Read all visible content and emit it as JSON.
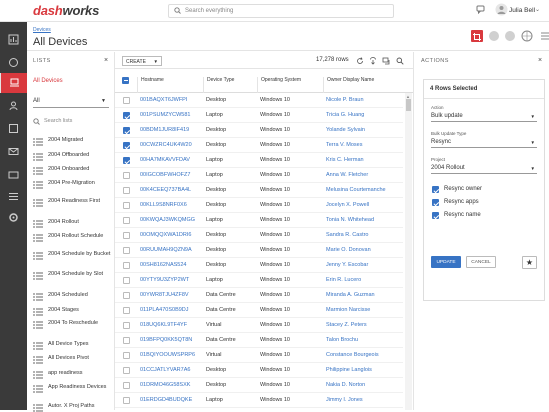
{
  "app": {
    "logo_a": "dash",
    "logo_b": "works",
    "search_placeholder": "Search everything",
    "user_name": "Julia Bell"
  },
  "page": {
    "breadcrumb": "Devices",
    "title": "All Devices"
  },
  "lists_panel": {
    "header": "LISTS",
    "all_label": "All Devices",
    "filter_value": "All",
    "search_placeholder": "Search lists",
    "items": [
      "2004 Migrated",
      "2004 Offboarded",
      "2004 Onboarded",
      "2004 Pre-Migration",
      "2004 Readiness First",
      "2004 Rollout",
      "2004 Rollout Schedule",
      "2004 Schedule by Bucket",
      "2004 Schedule by Slot",
      "2004 Scheduled",
      "2004 Stages",
      "2004 To Reschedule",
      "All Device Types",
      "All Devices Pivot",
      "app readiness",
      "App Readiness Devices",
      "Autor. X Proj Paths"
    ]
  },
  "toolbar": {
    "create_label": "CREATE",
    "row_count": "17,278 rows"
  },
  "grid": {
    "columns": [
      "Hostname",
      "Device Type",
      "Operating System",
      "Owner Display Name"
    ],
    "rows": [
      {
        "checked": false,
        "hostname": "001BAQXT6JWFPI",
        "type": "Desktop",
        "os": "Windows 10",
        "owner": "Nicole P. Braun"
      },
      {
        "checked": true,
        "hostname": "001PSUMZYCW581",
        "type": "Laptop",
        "os": "Windows 10",
        "owner": "Tricia G. Huang"
      },
      {
        "checked": true,
        "hostname": "00BDM1JUR8IF419",
        "type": "Desktop",
        "os": "Windows 10",
        "owner": "Yolande Sylvain"
      },
      {
        "checked": true,
        "hostname": "00CWZRC4UK4W20",
        "type": "Desktop",
        "os": "Windows 10",
        "owner": "Terra V. Moses"
      },
      {
        "checked": true,
        "hostname": "00HA7MKAVVFDAV",
        "type": "Laptop",
        "os": "Windows 10",
        "owner": "Kris C. Herman"
      },
      {
        "checked": false,
        "hostname": "00IGCOBFWHOFZ7",
        "type": "Laptop",
        "os": "Windows 10",
        "owner": "Anna W. Fletcher"
      },
      {
        "checked": false,
        "hostname": "00K4CEEQ737BA4L",
        "type": "Desktop",
        "os": "Windows 10",
        "owner": "Melusina Courtemanche"
      },
      {
        "checked": false,
        "hostname": "00KLL9S8NRF0X6",
        "type": "Desktop",
        "os": "Windows 10",
        "owner": "Jocelyn X. Powell"
      },
      {
        "checked": false,
        "hostname": "00KWQAJ3WKQMGG",
        "type": "Laptop",
        "os": "Windows 10",
        "owner": "Tonia N. Whitehead"
      },
      {
        "checked": false,
        "hostname": "00OMQQXWA1DRI6",
        "type": "Desktop",
        "os": "Windows 10",
        "owner": "Sandra R. Castro"
      },
      {
        "checked": false,
        "hostname": "00RUUMAH9QZN9A",
        "type": "Desktop",
        "os": "Windows 10",
        "owner": "Marie O. Donovan"
      },
      {
        "checked": false,
        "hostname": "00SH8162NAS524",
        "type": "Desktop",
        "os": "Windows 10",
        "owner": "Jenny Y. Escobar"
      },
      {
        "checked": false,
        "hostname": "00YTY9U3ZYP2WT",
        "type": "Laptop",
        "os": "Windows 10",
        "owner": "Erin R. Lucero"
      },
      {
        "checked": false,
        "hostname": "00YWR8TJU4ZF8V",
        "type": "Data Centre",
        "os": "Windows 10",
        "owner": "Miranda A. Guzman"
      },
      {
        "checked": false,
        "hostname": "011PLA470S0B9DJ",
        "type": "Data Centre",
        "os": "Windows 10",
        "owner": "Marmion Narcisse"
      },
      {
        "checked": false,
        "hostname": "018UQ6KL9TF4YF",
        "type": "Virtual",
        "os": "Windows 10",
        "owner": "Stacey Z. Peters"
      },
      {
        "checked": false,
        "hostname": "019BFPQ0KK5QT8N",
        "type": "Data Centre",
        "os": "Windows 10",
        "owner": "Talon Brochu"
      },
      {
        "checked": false,
        "hostname": "01BQIYOOUWSPRP6",
        "type": "Virtual",
        "os": "Windows 10",
        "owner": "Constance Bourgeois"
      },
      {
        "checked": false,
        "hostname": "01CCJATLYVAR7A6",
        "type": "Desktop",
        "os": "Windows 10",
        "owner": "Philippine Langlois"
      },
      {
        "checked": false,
        "hostname": "01DRMO46G58SXK",
        "type": "Desktop",
        "os": "Windows 10",
        "owner": "Nakia D. Norton"
      },
      {
        "checked": false,
        "hostname": "01ERDGD4BUDQKE",
        "type": "Laptop",
        "os": "Windows 10",
        "owner": "Jimmy I. Jones"
      }
    ]
  },
  "actions": {
    "header": "ACTIONS",
    "selected": "4 Rows Selected",
    "action_label": "Action",
    "action_value": "Bulk update",
    "type_label": "Bulk Update Type",
    "type_value": "Resync",
    "project_label": "Project",
    "project_value": "2004 Rollout",
    "checks": [
      {
        "label": "Resync owner",
        "checked": true
      },
      {
        "label": "Resync apps",
        "checked": true
      },
      {
        "label": "Resync name",
        "checked": true
      }
    ],
    "update_label": "UPDATE",
    "cancel_label": "CANCEL"
  },
  "colors": {
    "accent": "#d9393e",
    "link": "#3773c4",
    "rail": "#3a3a3a"
  }
}
